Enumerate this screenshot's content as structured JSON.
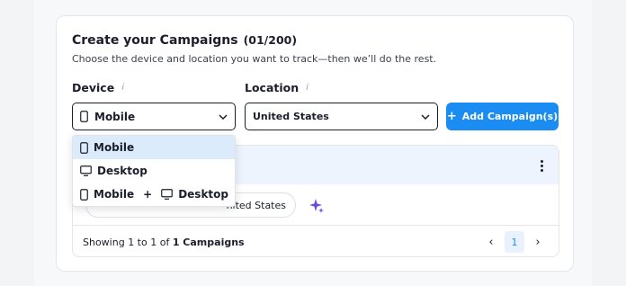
{
  "header": {
    "title": "Create your Campaigns",
    "count": "(01/200)",
    "subtitle": "Choose the device and location you want to track—then we’ll do the rest."
  },
  "device_field": {
    "label": "Device",
    "info_icon": "info-icon",
    "selected_value": "Mobile",
    "selected_icon": "mobile-icon"
  },
  "location_field": {
    "label": "Location",
    "info_icon": "info-icon",
    "selected_value": "United States"
  },
  "add_button": {
    "label": "Add Campaign(s)",
    "icon": "plus-icon",
    "color": "#1a8cf2"
  },
  "device_dropdown": {
    "options": [
      {
        "label": "Mobile",
        "icon": "mobile-icon",
        "selected": true
      },
      {
        "label": "Desktop",
        "icon": "desktop-icon",
        "selected": false
      },
      {
        "label_a": "Mobile",
        "sep": "+",
        "label_b": "Desktop",
        "icons": [
          "mobile-icon",
          "desktop-icon"
        ],
        "selected": false
      }
    ]
  },
  "campaign_row": {
    "location_tag": "nited States"
  },
  "footer": {
    "showing_prefix": "Showing 1 to 1 of",
    "showing_total": "1 Campaigns",
    "current_page": "1"
  }
}
